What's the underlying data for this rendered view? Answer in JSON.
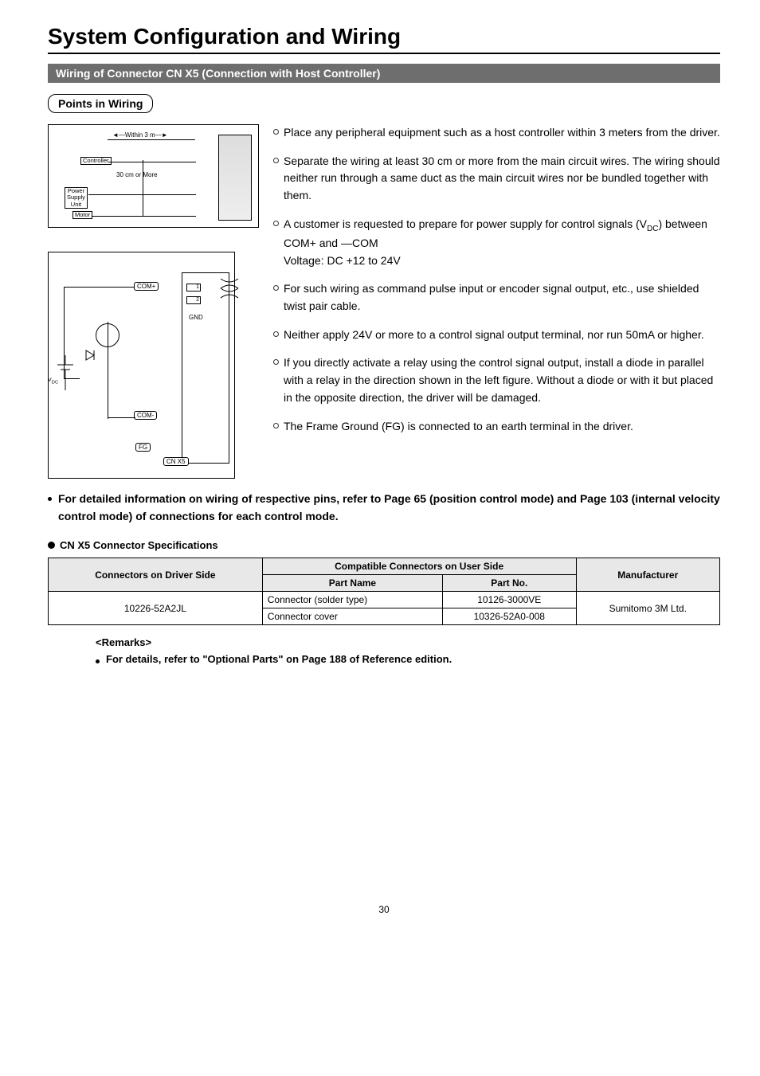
{
  "title": "System Configuration and Wiring",
  "section_bar": "Wiring of Connector CN X5 (Connection with Host Controller)",
  "sub_heading": "Points in Wiring",
  "diagram1": {
    "within": "Within 3 m",
    "controller": "Controller",
    "thirty": "30 cm or More",
    "psu": "Power\nSupply\nUnit",
    "motor": "Motor"
  },
  "diagram2": {
    "vdc": "VDC",
    "com_plus": "COM+",
    "com_minus": "COM-",
    "fg": "FG",
    "cnx5": "CN X5",
    "gnd": "GND",
    "pin1": "1",
    "pin2": "2"
  },
  "bullets": [
    "Place any peripheral equipment such as a host controller within 3 meters from the driver.",
    "Separate the wiring at least 30 cm or more from the main circuit wires. The wiring should neither run through a same duct as the main circuit wires nor be bundled together with them.",
    "A customer is requested to prepare for power supply for control signals (VDC) between COM+ and —COM\nVoltage: DC +12 to 24V",
    "For such wiring as command pulse input or encoder signal output, etc., use shielded twist pair cable.",
    "Neither apply 24V or more to a control signal output terminal, nor run 50mA or higher.",
    "If you directly activate a relay using the control signal output, install a diode in parallel with a relay in the direction shown in the left figure. Without a diode or with it but placed in the opposite direction, the driver will be damaged.",
    "The Frame Ground (FG) is connected to an earth terminal in the driver."
  ],
  "note": "For detailed information on wiring of respective pins, refer to Page 65 (position control mode) and Page 103 (internal velocity control mode) of connections for each control mode.",
  "spec_heading": "CN X5 Connector Specifications",
  "table": {
    "header_driver": "Connectors on Driver Side",
    "header_compat": "Compatible Connectors on User Side",
    "header_partname": "Part Name",
    "header_partno": "Part No.",
    "header_manu": "Manufacturer",
    "driver_val": "10226-52A2JL",
    "row1_name": "Connector (solder type)",
    "row1_no": "10126-3000VE",
    "row2_name": "Connector cover",
    "row2_no": "10326-52A0-008",
    "manu_val": "Sumitomo 3M Ltd."
  },
  "remarks_hd": "<Remarks>",
  "remarks_line": "For details, refer to \"Optional Parts\" on Page 188 of Reference edition.",
  "page_no": "30"
}
